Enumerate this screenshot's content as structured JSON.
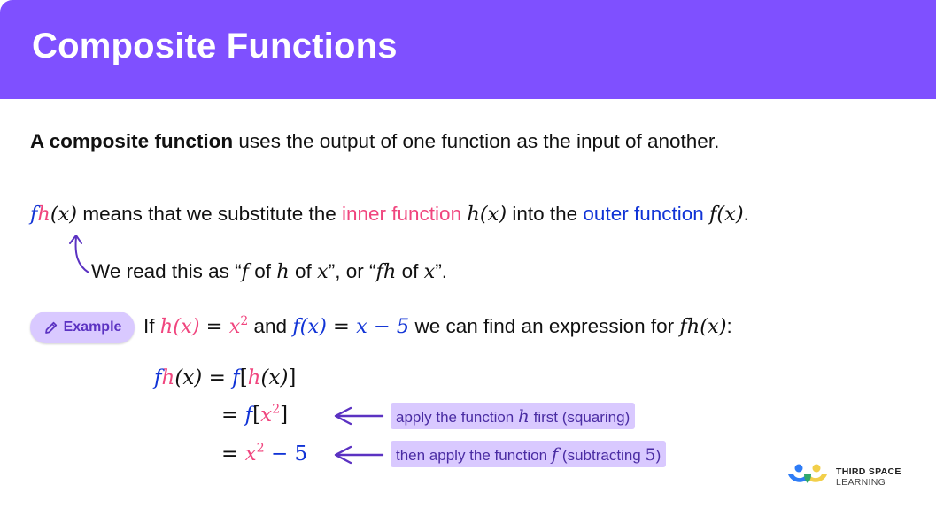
{
  "header": {
    "title": "Composite Functions",
    "color": "#7f50ff"
  },
  "definition": {
    "bold": "A composite function",
    "rest": " uses the output of one function as the input of another."
  },
  "notation": {
    "f": "f",
    "h": "h",
    "x_paren": "(x)",
    "t1": " means that we substitute the ",
    "inner": "inner function",
    "h_of_x": "h(x)",
    "t2": " into the ",
    "outer": "outer function",
    "f_of_x": "f(x)",
    "end": "."
  },
  "reading": {
    "t1": "We read this as “",
    "f": "f",
    "t2": " of ",
    "h": "h",
    "t3": " of ",
    "x": "x",
    "t4": "”, or “",
    "fh": "fh",
    "t5": " of ",
    "x2": "x",
    "t6": "”."
  },
  "example": {
    "badge_label": "Example",
    "badge_icon": "pencil-icon",
    "t_if": "If ",
    "h_of_x": "h(x)",
    "eq1": " = ",
    "x": "x",
    "sq": "2",
    "t_and": " and ",
    "f_of_x": "f(x)",
    "eq2": " = ",
    "rhs": "x − 5",
    "t_end": " we can find an expression for ",
    "fh_of_x": "fh(x)",
    "colon": ":"
  },
  "working": {
    "line1": {
      "f": "f",
      "h": "h",
      "x": "(x)",
      "eq": " = ",
      "f2": "f",
      "lb": "[",
      "h2": "h",
      "x2": "(x)",
      "rb": "]"
    },
    "line2": {
      "eq": "= ",
      "f": "f",
      "lb": "[",
      "x": "x",
      "sq": "2",
      "rb": "]"
    },
    "line3": {
      "eq": "= ",
      "x": "x",
      "sq": "2",
      "minus": " − 5"
    }
  },
  "annotations": [
    {
      "t1": "apply the function ",
      "var": "h",
      "t2": " first (squaring)"
    },
    {
      "t1": "then apply the function ",
      "var": "f",
      "t2": " (subtracting ",
      "num": "5",
      "t3": ")"
    }
  ],
  "logo": {
    "line1": "THIRD SPACE",
    "line2": "LEARNING"
  },
  "colors": {
    "inner": "#f0457e",
    "outer": "#1033d6",
    "annotation_bg": "#d9c9ff",
    "arrow": "#5b32c2"
  }
}
